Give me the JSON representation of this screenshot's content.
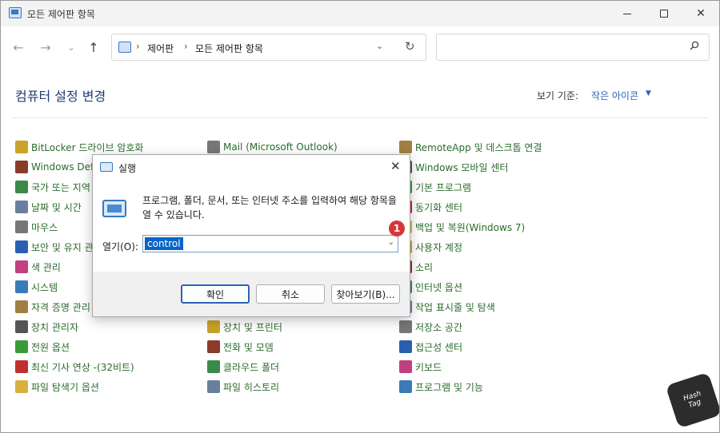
{
  "window": {
    "title": "모든 제어판 항목"
  },
  "address": {
    "crumbs": [
      "제어판",
      "모든 제어판 항목"
    ]
  },
  "content": {
    "heading": "컴퓨터 설정 변경",
    "view_by_label": "보기 기준:",
    "view_by_value": "작은 아이콘"
  },
  "items": {
    "col1": [
      "BitLocker 드라이브 암호화",
      "Windows Defe",
      "국가 또는 지역",
      "날짜 및 시간",
      "마우스",
      "보안 및 유지 관",
      "색 관리",
      "시스템",
      "자격 증명 관리",
      "장치 관리자",
      "전원 옵션",
      "최신 기사 연상 -(32비트)",
      "파일 탐색기 옵션"
    ],
    "col2": [
      "Mail (Microsoft Outlook)",
      "",
      "",
      "",
      "",
      "",
      "",
      "",
      "",
      "장치 및 프린터",
      "전화 및 모뎀",
      "클라우드 폴더",
      "파일 히스토리"
    ],
    "col3": [
      "RemoteApp 및 데스크톱 연결",
      "Windows 모바일 센터",
      "기본 프로그램",
      "동기화 센터",
      "백업 및 복원(Windows 7)",
      "사용자 계정",
      "소리",
      "인터넷 옵션",
      "작업 표시줄 및 탐색",
      "저장소 공간",
      "접근성 센터",
      "키보드",
      "프로그램 및 기능"
    ]
  },
  "dialog": {
    "title": "실행",
    "description": "프로그램, 폴더, 문서, 또는 인터넷 주소를 입력하여 해당 항목을 열 수 있습니다.",
    "open_label": "열기(O):",
    "open_value": "control",
    "badge": "1",
    "ok": "확인",
    "cancel": "취소",
    "browse": "찾아보기(B)..."
  },
  "watermark": {
    "line1": "Hash",
    "line2": "Tag"
  },
  "colors": {
    "accent": "#2a63b8",
    "link_green": "#2b6b2b",
    "badge_red": "#d9363a"
  }
}
